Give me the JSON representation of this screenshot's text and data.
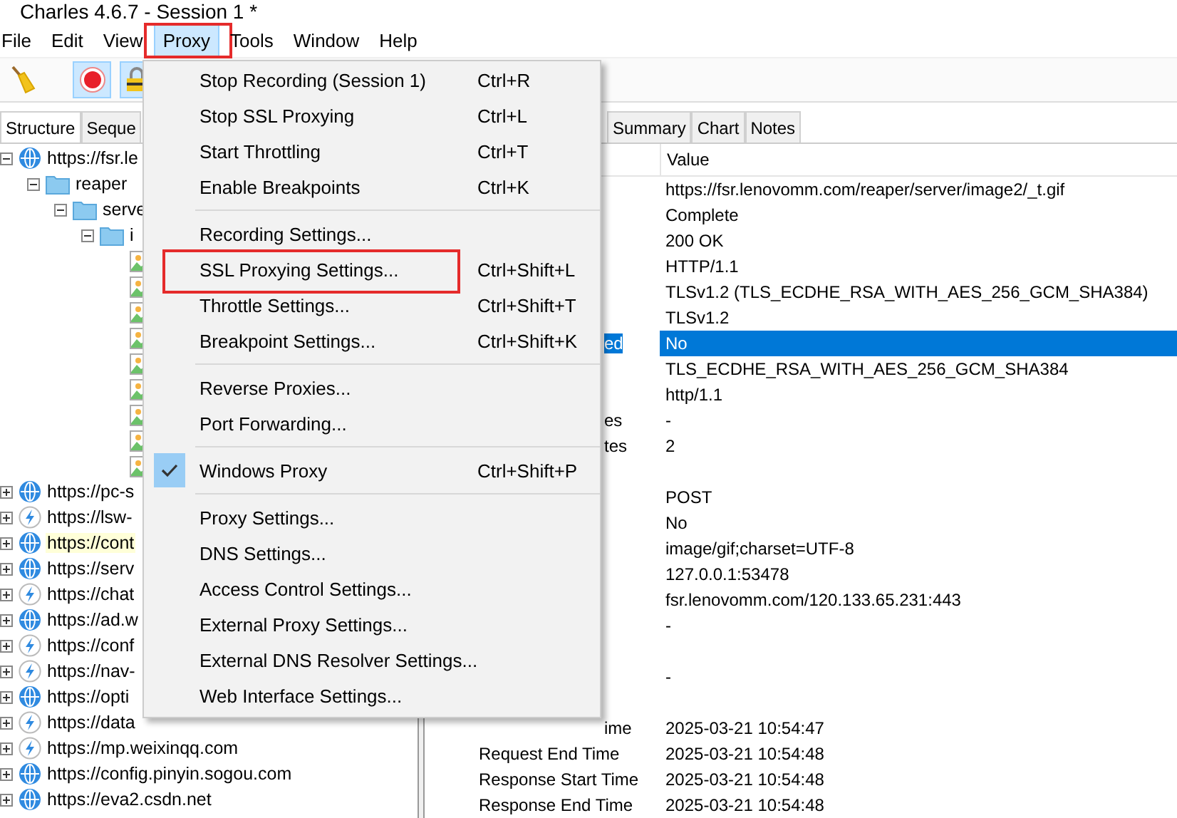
{
  "window": {
    "title": "Charles 4.6.7 - Session 1 *"
  },
  "menubar": [
    {
      "label": "File",
      "open": false,
      "annotated": false
    },
    {
      "label": "Edit",
      "open": false,
      "annotated": false
    },
    {
      "label": "View",
      "open": false,
      "annotated": false
    },
    {
      "label": "Proxy",
      "open": true,
      "annotated": true
    },
    {
      "label": "Tools",
      "open": false,
      "annotated": false
    },
    {
      "label": "Window",
      "open": false,
      "annotated": false
    },
    {
      "label": "Help",
      "open": false,
      "annotated": false
    }
  ],
  "toolbar": [
    {
      "kind": "broom",
      "on": false
    },
    {
      "kind": "record",
      "on": true
    },
    {
      "kind": "lock",
      "on": true
    }
  ],
  "left_tabs": [
    {
      "label": "Structure",
      "selected": true
    },
    {
      "label": "Seque",
      "selected": false
    }
  ],
  "tree": [
    {
      "kind": "globe",
      "label": "https://fsr.le",
      "expanded": true,
      "highlighted": false,
      "children": [
        {
          "kind": "folder",
          "label": "reaper",
          "expanded": true,
          "children": [
            {
              "kind": "folder",
              "label": "serve",
              "expanded": true,
              "children": [
                {
                  "kind": "folder",
                  "label": "i",
                  "expanded": true,
                  "children": [
                    {
                      "kind": "image"
                    },
                    {
                      "kind": "image"
                    },
                    {
                      "kind": "image"
                    },
                    {
                      "kind": "image"
                    },
                    {
                      "kind": "image"
                    },
                    {
                      "kind": "image"
                    },
                    {
                      "kind": "image"
                    },
                    {
                      "kind": "image"
                    },
                    {
                      "kind": "image"
                    }
                  ]
                }
              ]
            }
          ]
        }
      ]
    },
    {
      "kind": "globe",
      "label": "https://pc-s",
      "expanded": false,
      "highlighted": false
    },
    {
      "kind": "bolt",
      "label": "https://lsw-",
      "expanded": false,
      "highlighted": false
    },
    {
      "kind": "globe",
      "label": "https://cont",
      "expanded": false,
      "highlighted": true
    },
    {
      "kind": "globe",
      "label": "https://serv",
      "expanded": false,
      "highlighted": false
    },
    {
      "kind": "bolt",
      "label": "https://chat",
      "expanded": false,
      "highlighted": false
    },
    {
      "kind": "globe",
      "label": "https://ad.w",
      "expanded": false,
      "highlighted": false
    },
    {
      "kind": "bolt",
      "label": "https://conf",
      "expanded": false,
      "highlighted": false
    },
    {
      "kind": "bolt",
      "label": "https://nav-",
      "expanded": false,
      "highlighted": false
    },
    {
      "kind": "globe",
      "label": "https://opti",
      "expanded": false,
      "highlighted": false
    },
    {
      "kind": "bolt",
      "label": "https://data",
      "expanded": false,
      "highlighted": false
    },
    {
      "kind": "bolt",
      "label": "https://mp.weixinqq.com",
      "expanded": false,
      "highlighted": false
    },
    {
      "kind": "globe",
      "label": "https://config.pinyin.sogou.com",
      "expanded": false,
      "highlighted": false
    },
    {
      "kind": "globe",
      "label": "https://eva2.csdn.net",
      "expanded": false,
      "highlighted": false
    }
  ],
  "right_tabs": [
    {
      "label": "Summary",
      "selected": false
    },
    {
      "label": "Chart",
      "selected": false
    },
    {
      "label": "Notes",
      "selected": false
    }
  ],
  "table": {
    "columns": [
      "Value"
    ],
    "rows": [
      {
        "kind": "row",
        "value": "https://fsr.lenovomm.com/reaper/server/image2/_t.gif",
        "selected": false
      },
      {
        "kind": "row",
        "value": "Complete",
        "selected": false
      },
      {
        "kind": "row",
        "value": "200 OK",
        "selected": false
      },
      {
        "kind": "row",
        "value": "HTTP/1.1",
        "selected": false
      },
      {
        "kind": "row",
        "value": "TLSv1.2 (TLS_ECDHE_RSA_WITH_AES_256_GCM_SHA384)",
        "selected": false
      },
      {
        "kind": "row",
        "value": "TLSv1.2",
        "selected": false
      },
      {
        "kind": "row",
        "name": "ed",
        "name_cut": true,
        "value": "No",
        "selected": true
      },
      {
        "kind": "row",
        "value": "TLS_ECDHE_RSA_WITH_AES_256_GCM_SHA384",
        "selected": false
      },
      {
        "kind": "row",
        "value": "http/1.1",
        "selected": false
      },
      {
        "kind": "row",
        "name": "es",
        "name_cut": true,
        "value": "-",
        "selected": false
      },
      {
        "kind": "row",
        "name": "tes",
        "name_cut": true,
        "value": "2",
        "selected": false
      },
      {
        "kind": "section"
      },
      {
        "kind": "row",
        "value": "POST",
        "selected": false
      },
      {
        "kind": "row",
        "value": "No",
        "selected": false
      },
      {
        "kind": "row",
        "value": "image/gif;charset=UTF-8",
        "selected": false
      },
      {
        "kind": "row",
        "value": "127.0.0.1:53478",
        "selected": false
      },
      {
        "kind": "row",
        "value": "fsr.lenovomm.com/120.133.65.231:443",
        "selected": false
      },
      {
        "kind": "row",
        "value": "-",
        "selected": false
      },
      {
        "kind": "section"
      },
      {
        "kind": "row",
        "value": "-",
        "selected": false
      },
      {
        "kind": "section"
      },
      {
        "kind": "row",
        "name": "ime",
        "name_cut": true,
        "value": "2025-03-21 10:54:47",
        "selected": false
      },
      {
        "kind": "row",
        "name": "Request End Time",
        "name_cut": false,
        "value": "2025-03-21 10:54:48",
        "selected": false
      },
      {
        "kind": "row",
        "name": "Response Start Time",
        "name_cut": false,
        "value": "2025-03-21 10:54:48",
        "selected": false
      },
      {
        "kind": "row",
        "name": "Response End Time",
        "name_cut": false,
        "value": "2025-03-21 10:54:48",
        "selected": false
      }
    ]
  },
  "proxy_menu": {
    "groups": [
      [
        {
          "label": "Stop Recording (Session 1)",
          "shortcut": "Ctrl+R",
          "checked": false,
          "annotated": false
        },
        {
          "label": "Stop SSL Proxying",
          "shortcut": "Ctrl+L",
          "checked": false,
          "annotated": false
        },
        {
          "label": "Start Throttling",
          "shortcut": "Ctrl+T",
          "checked": false,
          "annotated": false
        },
        {
          "label": "Enable Breakpoints",
          "shortcut": "Ctrl+K",
          "checked": false,
          "annotated": false
        }
      ],
      [
        {
          "label": "Recording Settings...",
          "checked": false,
          "annotated": false
        },
        {
          "label": "SSL Proxying Settings...",
          "shortcut": "Ctrl+Shift+L",
          "checked": false,
          "annotated": true
        },
        {
          "label": "Throttle Settings...",
          "shortcut": "Ctrl+Shift+T",
          "checked": false,
          "annotated": false
        },
        {
          "label": "Breakpoint Settings...",
          "shortcut": "Ctrl+Shift+K",
          "checked": false,
          "annotated": false
        }
      ],
      [
        {
          "label": "Reverse Proxies...",
          "checked": false,
          "annotated": false
        },
        {
          "label": "Port Forwarding...",
          "checked": false,
          "annotated": false
        }
      ],
      [
        {
          "label": "Windows Proxy",
          "shortcut": "Ctrl+Shift+P",
          "checked": true,
          "annotated": false
        }
      ],
      [
        {
          "label": "Proxy Settings...",
          "checked": false,
          "annotated": false
        },
        {
          "label": "DNS Settings...",
          "checked": false,
          "annotated": false
        },
        {
          "label": "Access Control Settings...",
          "checked": false,
          "annotated": false
        },
        {
          "label": "External Proxy Settings...",
          "checked": false,
          "annotated": false
        },
        {
          "label": "External DNS Resolver Settings...",
          "checked": false,
          "annotated": false
        },
        {
          "label": "Web Interface Settings...",
          "checked": false,
          "annotated": false
        }
      ]
    ]
  }
}
